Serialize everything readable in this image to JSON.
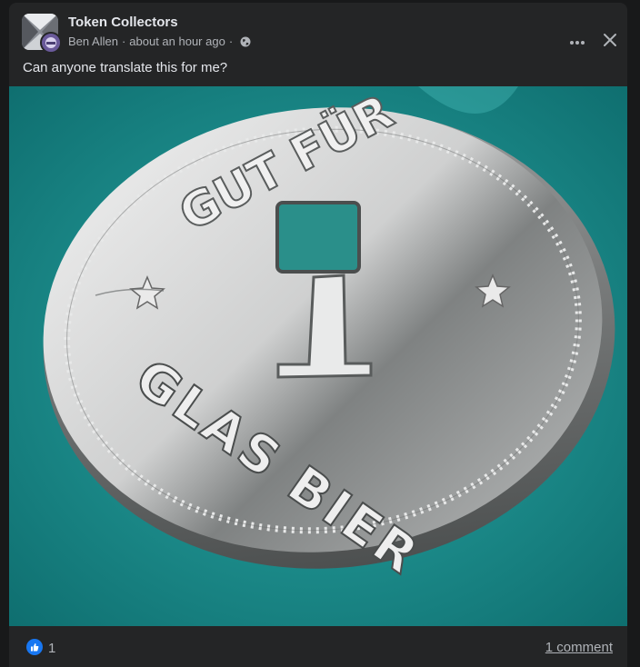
{
  "post": {
    "group_name": "Token Collectors",
    "author": "Ben Allen",
    "timestamp": "about an hour ago",
    "separator": "·",
    "privacy_icon": "globe-icon",
    "text": "Can anyone translate this for me?"
  },
  "actions": {
    "more_icon": "more-options-icon",
    "close_icon": "close-icon"
  },
  "photo": {
    "subject": "coin-token",
    "coin_top_text": "GUT FÜR",
    "coin_value": "1",
    "coin_bottom_text": "GLAS BIER"
  },
  "footer": {
    "reaction_icon": "like-icon",
    "reaction_count": "1",
    "comments": "1 comment"
  },
  "colors": {
    "background": "#18191a",
    "card": "#242526",
    "primary_text": "#e4e6eb",
    "secondary_text": "#b0b3b8",
    "like_blue": "#1877f2",
    "photo_teal": "#1d8c8a"
  }
}
